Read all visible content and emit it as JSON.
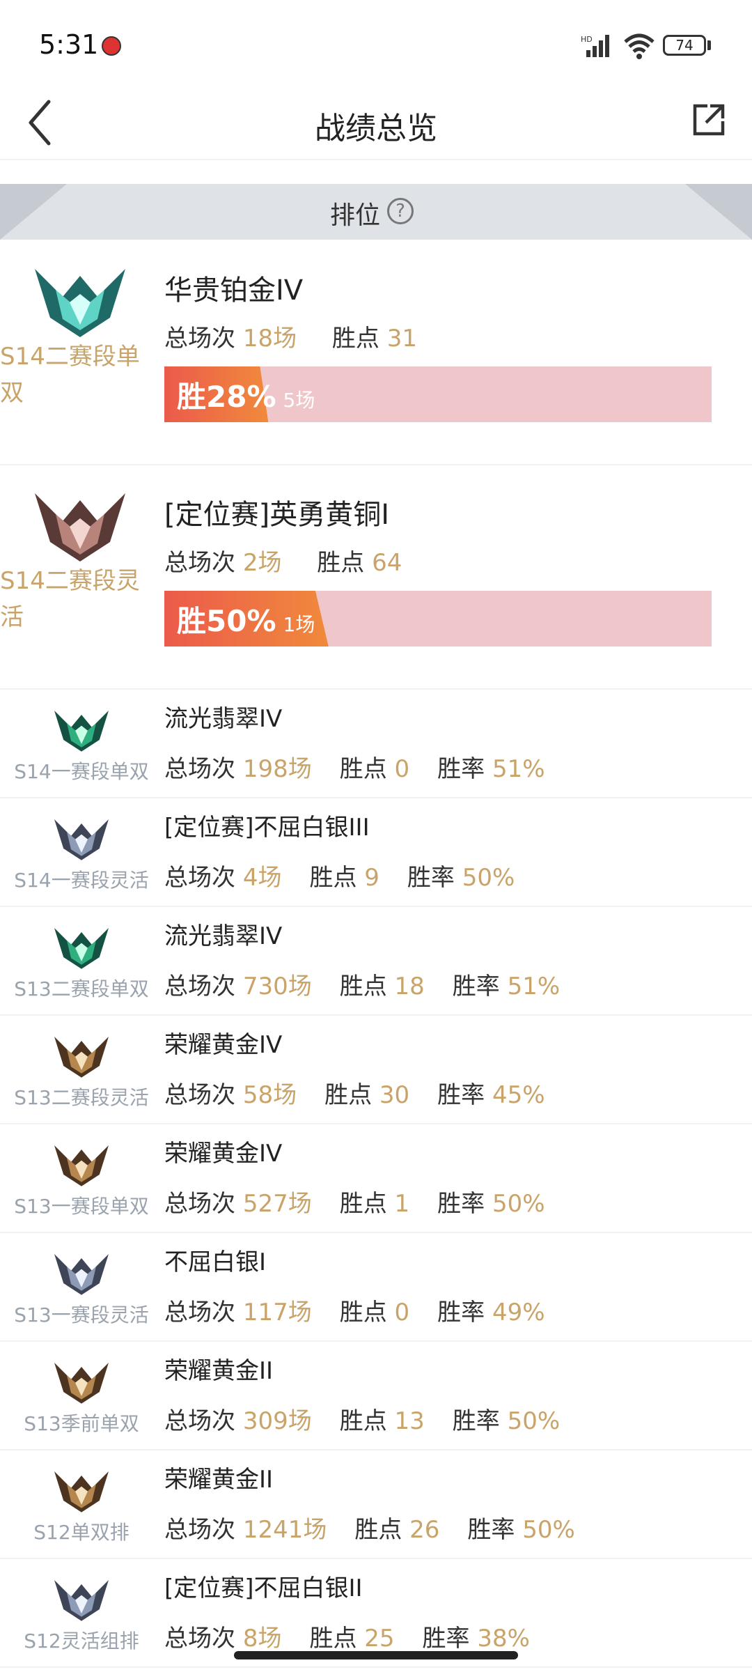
{
  "status": {
    "time": "5:31",
    "battery": "74"
  },
  "header": {
    "title": "战绩总览"
  },
  "section": {
    "label": "排位",
    "help_glyph": "?"
  },
  "labels": {
    "total": "总场次",
    "points": "胜点",
    "winrate": "胜率",
    "win": "胜"
  },
  "colors": {
    "accent": "#c9a46a",
    "bar_bg": "#efc7ca",
    "bar_fill_start": "#ec5a4b",
    "bar_fill_end": "#f08a3c"
  },
  "big_cards": [
    {
      "season": "S14二赛段单双",
      "rank": "华贵铂金IV",
      "games": "18场",
      "points": "31",
      "win_pct": "28%",
      "win_games": "5场",
      "win_fraction": 0.28,
      "emblem": "platinum-emblem-icon"
    },
    {
      "season": "S14二赛段灵活",
      "rank": "[定位赛]英勇黄铜I",
      "games": "2场",
      "points": "64",
      "win_pct": "50%",
      "win_games": "1场",
      "win_fraction": 0.5,
      "emblem": "bronze-emblem-icon"
    }
  ],
  "rows": [
    {
      "season": "S14一赛段单双",
      "rank": "流光翡翠IV",
      "games": "198场",
      "points": "0",
      "winrate": "51%",
      "emblem": "emerald-emblem-icon"
    },
    {
      "season": "S14一赛段灵活",
      "rank": "[定位赛]不屈白银III",
      "games": "4场",
      "points": "9",
      "winrate": "50%",
      "emblem": "silver-emblem-icon"
    },
    {
      "season": "S13二赛段单双",
      "rank": "流光翡翠IV",
      "games": "730场",
      "points": "18",
      "winrate": "51%",
      "emblem": "emerald-emblem-icon"
    },
    {
      "season": "S13二赛段灵活",
      "rank": "荣耀黄金IV",
      "games": "58场",
      "points": "30",
      "winrate": "45%",
      "emblem": "gold-emblem-icon"
    },
    {
      "season": "S13一赛段单双",
      "rank": "荣耀黄金IV",
      "games": "527场",
      "points": "1",
      "winrate": "50%",
      "emblem": "gold-emblem-icon"
    },
    {
      "season": "S13一赛段灵活",
      "rank": "不屈白银I",
      "games": "117场",
      "points": "0",
      "winrate": "49%",
      "emblem": "silver-emblem-icon"
    },
    {
      "season": "S13季前单双",
      "rank": "荣耀黄金II",
      "games": "309场",
      "points": "13",
      "winrate": "50%",
      "emblem": "gold-emblem-icon"
    },
    {
      "season": "S12单双排",
      "rank": "荣耀黄金II",
      "games": "1241场",
      "points": "26",
      "winrate": "50%",
      "emblem": "gold-emblem-icon"
    },
    {
      "season": "S12灵活组排",
      "rank": "[定位赛]不屈白银II",
      "games": "8场",
      "points": "25",
      "winrate": "38%",
      "emblem": "silver-emblem-icon"
    }
  ]
}
